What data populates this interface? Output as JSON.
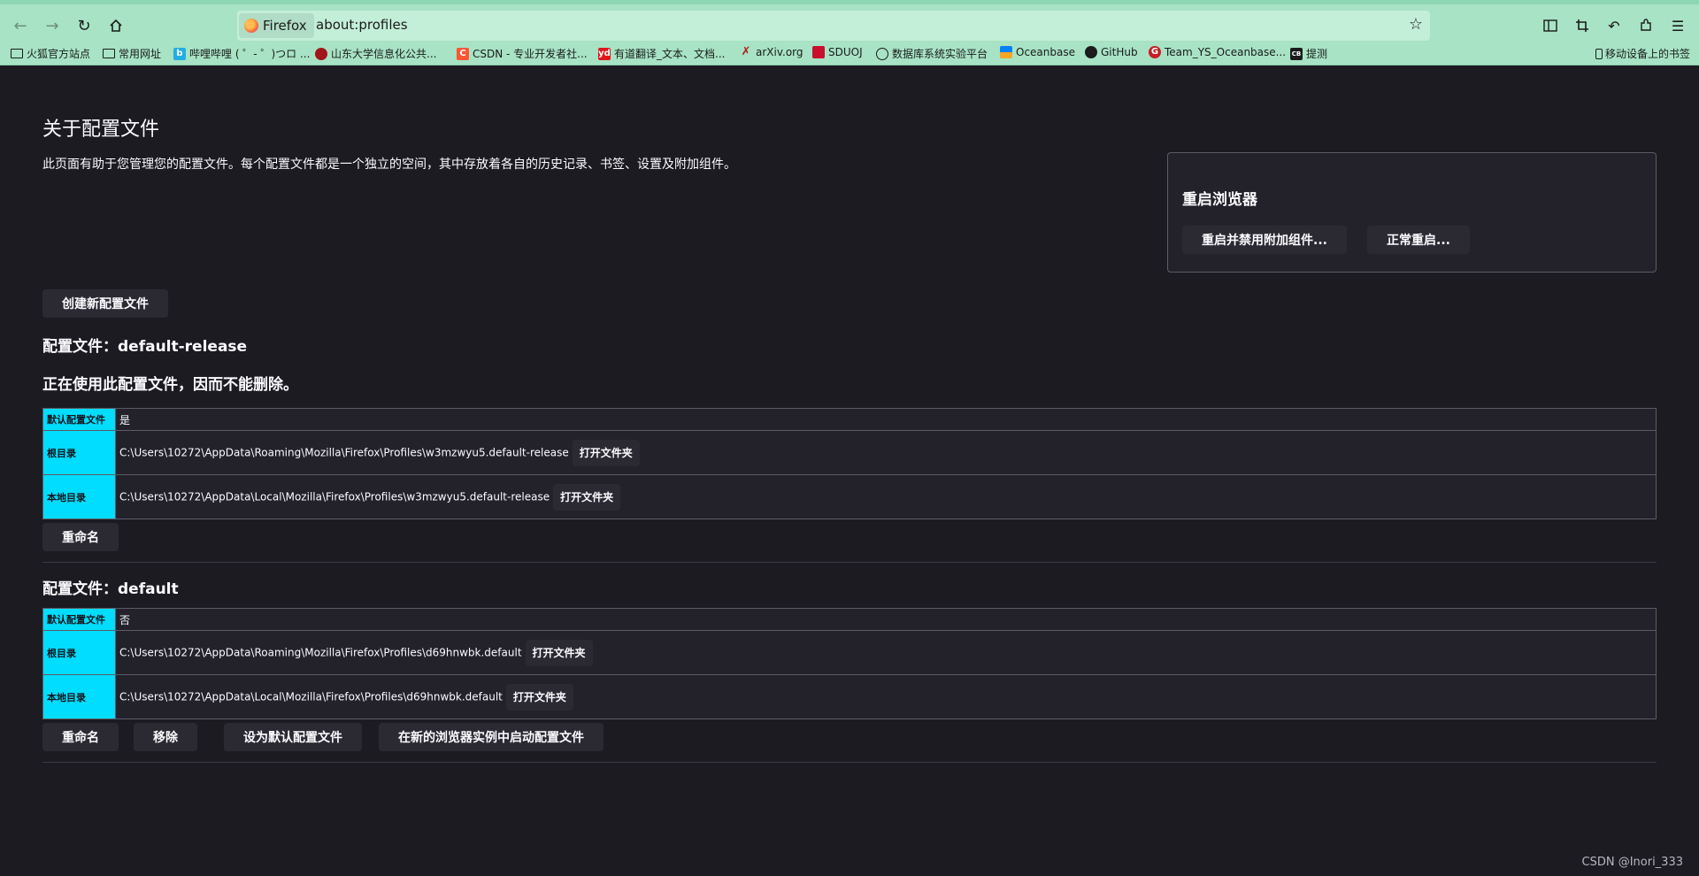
{
  "browser": {
    "identity_label": "Firefox",
    "url": "about:profiles",
    "back_icon": "back-arrow-icon",
    "forward_icon": "forward-arrow-icon",
    "reload_icon": "reload-icon",
    "home_icon": "home-icon"
  },
  "bookmarks": [
    {
      "label": "火狐官方站点",
      "icon": "folder-icon"
    },
    {
      "label": "常用网址",
      "icon": "folder-icon"
    },
    {
      "label": "哔哩哔哩 ( ゜- ゜)つロ ...",
      "icon": "bilibili-icon"
    },
    {
      "label": "山东大学信息化公共...",
      "icon": "sdu-icon"
    },
    {
      "label": "CSDN - 专业开发者社...",
      "icon": "csdn-icon"
    },
    {
      "label": "有道翻译_文本、文档...",
      "icon": "youdao-icon"
    },
    {
      "label": "arXiv.org",
      "icon": "arxiv-icon"
    },
    {
      "label": "SDUOJ",
      "icon": "sduoj-icon"
    },
    {
      "label": "数据库系统实验平台",
      "icon": "globe-icon"
    },
    {
      "label": "Oceanbase",
      "icon": "oceanbase-icon"
    },
    {
      "label": "GitHub",
      "icon": "github-icon"
    },
    {
      "label": "Team_YS_Oceanbase...",
      "icon": "gitee-icon"
    },
    {
      "label": "提测",
      "icon": "test-icon"
    }
  ],
  "bookmarks_right": "移动设备上的书签",
  "page": {
    "title": "关于配置文件",
    "intro": "此页面有助于您管理您的配置文件。每个配置文件都是一个独立的空间，其中存放着各自的历史记录、书签、设置及附加组件。",
    "create_button": "创建新配置文件"
  },
  "restart": {
    "title": "重启浏览器",
    "disable_addons_button": "重启并禁用附加组件...",
    "normal_button": "正常重启..."
  },
  "profiles": [
    {
      "heading": "配置文件：default-release",
      "note": "正在使用此配置文件，因而不能删除。",
      "rows": [
        {
          "key": "默认配置文件",
          "value": "是"
        },
        {
          "key": "根目录",
          "value": "C:\\Users\\10272\\AppData\\Roaming\\Mozilla\\Firefox\\Profiles\\w3mzwyu5.default-release",
          "button": "打开文件夹"
        },
        {
          "key": "本地目录",
          "value": "C:\\Users\\10272\\AppData\\Local\\Mozilla\\Firefox\\Profiles\\w3mzwyu5.default-release",
          "button": "打开文件夹"
        }
      ],
      "actions": [
        "重命名"
      ]
    },
    {
      "heading": "配置文件：default",
      "note": "",
      "rows": [
        {
          "key": "默认配置文件",
          "value": "否"
        },
        {
          "key": "根目录",
          "value": "C:\\Users\\10272\\AppData\\Roaming\\Mozilla\\Firefox\\Profiles\\d69hnwbk.default",
          "button": "打开文件夹"
        },
        {
          "key": "本地目录",
          "value": "C:\\Users\\10272\\AppData\\Local\\Mozilla\\Firefox\\Profiles\\d69hnwbk.default",
          "button": "打开文件夹"
        }
      ],
      "actions": [
        "重命名",
        "移除",
        "设为默认配置文件",
        "在新的浏览器实例中启动配置文件"
      ]
    }
  ],
  "watermark": "CSDN @Inori_333",
  "colors": {
    "toolbar": "#a7e3c4",
    "page_bg": "#1c1b22",
    "key_cell": "#00ddff",
    "button_bg": "#2b2a33"
  }
}
